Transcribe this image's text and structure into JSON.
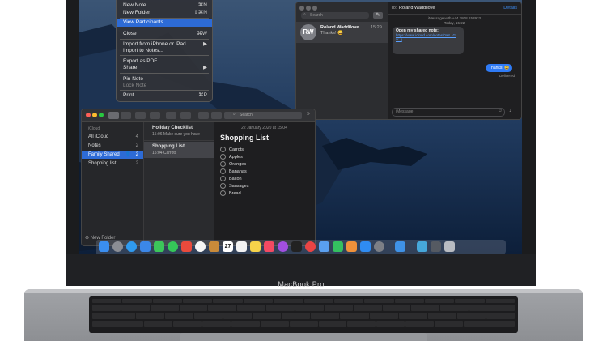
{
  "laptop": {
    "brand_label": "MacBook Pro"
  },
  "file_menu": {
    "new_note": {
      "label": "New Note",
      "shortcut": "⌘N"
    },
    "new_folder": {
      "label": "New Folder",
      "shortcut": "⇧⌘N"
    },
    "view_participants": "View Participants",
    "close": {
      "label": "Close",
      "shortcut": "⌘W"
    },
    "import_iphone": "Import from iPhone or iPad",
    "import_notes": "Import to Notes...",
    "export_pdf": "Export as PDF...",
    "share": "Share",
    "pin_note": "Pin Note",
    "lock_note": "Lock Note",
    "print": {
      "label": "Print...",
      "shortcut": "⌘P"
    }
  },
  "messages": {
    "search_placeholder": "Search",
    "conversation": {
      "initials": "RW",
      "name": "Roland Waddilove",
      "preview": "Thanks! 😀",
      "time": "15:29"
    },
    "to_label": "To:",
    "to_name": "Roland Waddilove",
    "details_label": "Details",
    "header_line1": "iMessage with +44 7808 158933",
    "header_line2": "Today, 15:22",
    "shared_note_title": "Open my shared note:",
    "shared_note_link": "https://www.icloud.com/notes/0a8...Gw...j",
    "reply": "Thanks! 😀",
    "delivered": "Delivered",
    "input_placeholder": "iMessage"
  },
  "notes": {
    "search_placeholder": "Search",
    "sidebar": {
      "section": "iCloud",
      "folders": [
        {
          "label": "All iCloud",
          "count": "4"
        },
        {
          "label": "Notes",
          "count": "2"
        },
        {
          "label": "Family Shared",
          "count": "2"
        },
        {
          "label": "Shopping list",
          "count": "2"
        }
      ],
      "new_folder": "New Folder"
    },
    "list": [
      {
        "title": "Holiday Checklist",
        "time": "15:06",
        "preview": "Make sure you have"
      },
      {
        "title": "Shopping List",
        "time": "15:04",
        "preview": "Carrots"
      }
    ],
    "note": {
      "date": "22 January 2020 at 15:04",
      "title": "Shopping List",
      "items": [
        "Carrots",
        "Apples",
        "Oranges",
        "Bananas",
        "Bacon",
        "Sausages",
        "Bread"
      ]
    }
  },
  "dock": {
    "calendar_day": "27"
  }
}
